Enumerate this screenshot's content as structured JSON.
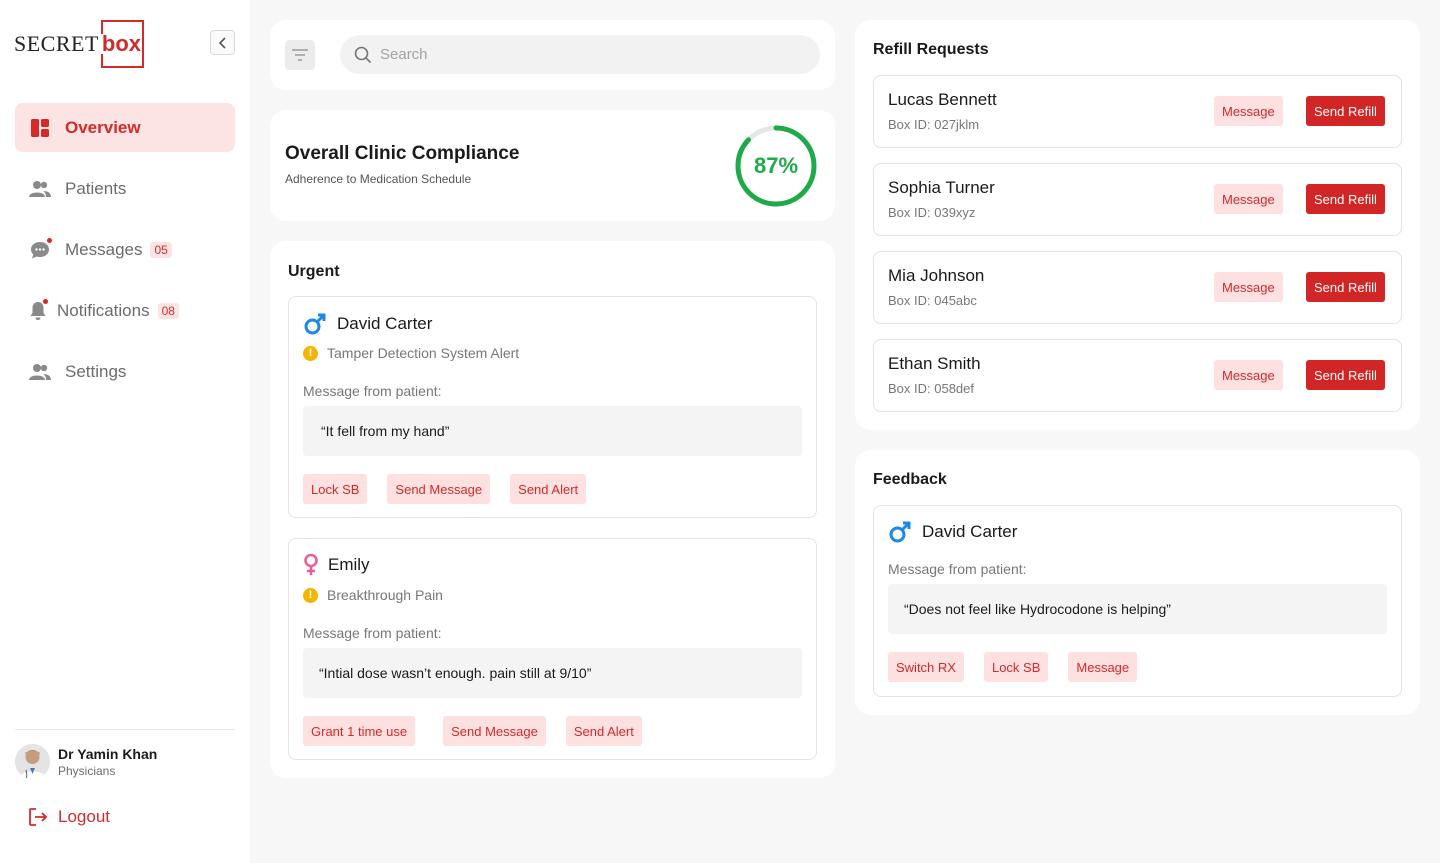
{
  "brand": {
    "secret": "SECRET",
    "box": "box"
  },
  "nav": {
    "overview": "Overview",
    "patients": "Patients",
    "messages": "Messages",
    "messages_badge": "05",
    "notifications": "Notifications",
    "notifications_badge": "08",
    "settings": "Settings"
  },
  "profile": {
    "name": "Dr Yamin Khan",
    "role": "Physicians"
  },
  "logout": "Logout",
  "search": {
    "placeholder": "Search"
  },
  "compliance": {
    "title": "Overall Clinic Compliance",
    "subtitle": "Adherence to Medication Schedule",
    "percent_label": "87%",
    "percent": 87
  },
  "urgent": {
    "title": "Urgent",
    "items": [
      {
        "name": "David Carter",
        "gender": "male-icon",
        "alert": "Tamper Detection System Alert",
        "msg_label": "Message from patient:",
        "quote": "“It fell from my hand”",
        "actions": [
          "Lock SB",
          "Send Message",
          "Send Alert"
        ]
      },
      {
        "name": "Emily",
        "gender": "female-icon",
        "alert": "Breakthrough Pain",
        "msg_label": "Message from patient:",
        "quote": "“Intial dose wasn’t enough. pain still at 9/10”",
        "actions": [
          "Grant 1 time use",
          "Send Message",
          "Send Alert"
        ]
      }
    ]
  },
  "refill": {
    "title": "Refill Requests",
    "message_label": "Message",
    "send_label": "Send Refill",
    "items": [
      {
        "name": "Lucas Bennett",
        "box_id": "Box ID: 027jklm"
      },
      {
        "name": "Sophia Turner",
        "box_id": "Box ID: 039xyz"
      },
      {
        "name": "Mia Johnson",
        "box_id": "Box ID: 045abc"
      },
      {
        "name": "Ethan Smith",
        "box_id": "Box ID: 058def"
      }
    ]
  },
  "feedback": {
    "title": "Feedback",
    "name": "David Carter",
    "gender": "male-icon",
    "msg_label": "Message from patient:",
    "quote": "“Does not feel like Hydrocodone is helping”",
    "actions": [
      "Switch RX",
      "Lock SB",
      "Message"
    ]
  },
  "colors": {
    "accent": "#d42a2a",
    "success": "#1faa49",
    "male": "#1e88e5",
    "female": "#e8609a",
    "warning": "#f5b400"
  }
}
